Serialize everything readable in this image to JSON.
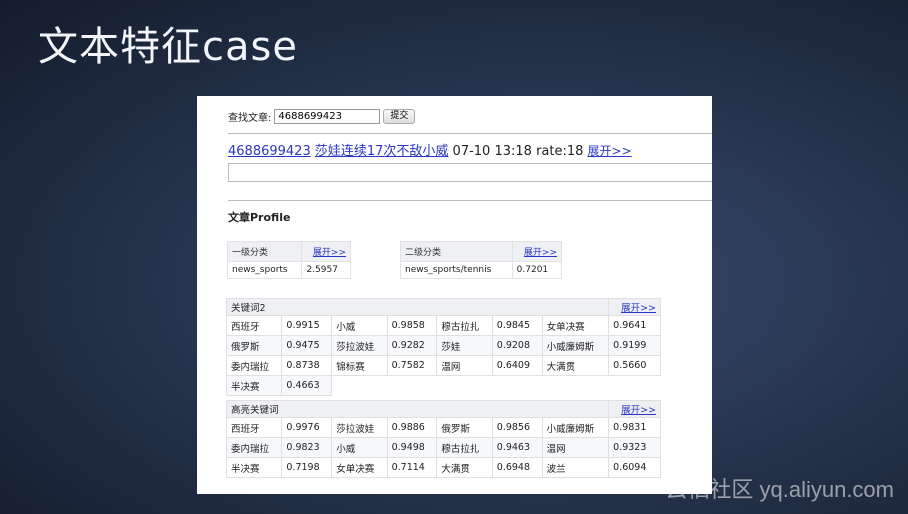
{
  "slide": {
    "title": "文本特征case",
    "watermark": "云栖社区 yq.aliyun.com"
  },
  "search": {
    "label": "查找文章:",
    "value": "4688699423",
    "submit_label": "提交"
  },
  "article": {
    "id": "4688699423",
    "title": "莎娃连续17次不敌小威",
    "date": "07-10 13:18",
    "rate": "rate:18",
    "expand_label": "展开>>"
  },
  "profile": {
    "section_title": "文章Profile",
    "category1": {
      "label": "一级分类",
      "expand_label": "展开>>",
      "name": "news_sports",
      "score": "2.5957"
    },
    "category2": {
      "label": "二级分类",
      "expand_label": "展开>>",
      "name": "news_sports/tennis",
      "score": "0.7201"
    },
    "keywords2": {
      "label": "关键词2",
      "expand_label": "展开>>",
      "rows": [
        [
          [
            "西班牙",
            "0.9915"
          ],
          [
            "小威",
            "0.9858"
          ],
          [
            "穆古拉扎",
            "0.9845"
          ],
          [
            "女单决赛",
            "0.9641"
          ]
        ],
        [
          [
            "俄罗斯",
            "0.9475"
          ],
          [
            "莎拉波娃",
            "0.9282"
          ],
          [
            "莎娃",
            "0.9208"
          ],
          [
            "小威廉姆斯",
            "0.9199"
          ]
        ],
        [
          [
            "委内瑞拉",
            "0.8738"
          ],
          [
            "锦标赛",
            "0.7582"
          ],
          [
            "温网",
            "0.6409"
          ],
          [
            "大满贯",
            "0.5660"
          ]
        ],
        [
          [
            "半决赛",
            "0.4663"
          ],
          [
            "",
            ""
          ],
          [
            "",
            ""
          ],
          [
            "",
            ""
          ]
        ]
      ]
    },
    "highlight_keywords": {
      "label": "高亮关键词",
      "expand_label": "展开>>",
      "rows": [
        [
          [
            "西班牙",
            "0.9976"
          ],
          [
            "莎拉波娃",
            "0.9886"
          ],
          [
            "俄罗斯",
            "0.9856"
          ],
          [
            "小威廉姆斯",
            "0.9831"
          ]
        ],
        [
          [
            "委内瑞拉",
            "0.9823"
          ],
          [
            "小威",
            "0.9498"
          ],
          [
            "穆古拉扎",
            "0.9463"
          ],
          [
            "温网",
            "0.9323"
          ]
        ],
        [
          [
            "半决赛",
            "0.7198"
          ],
          [
            "女单决赛",
            "0.7114"
          ],
          [
            "大满贯",
            "0.6948"
          ],
          [
            "波兰",
            "0.6094"
          ]
        ]
      ]
    }
  }
}
